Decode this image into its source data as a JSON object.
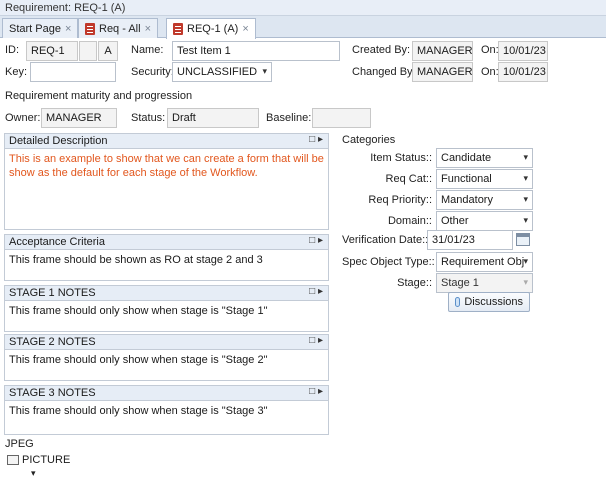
{
  "window": {
    "title": "Requirement: REQ-1 (A)"
  },
  "tabs": [
    {
      "label": "Start Page",
      "close": "×"
    },
    {
      "label": "Req - All",
      "close": "×"
    },
    {
      "label": "REQ-1 (A)",
      "close": "×"
    }
  ],
  "header": {
    "id_label": "ID:",
    "id_value": "REQ-1",
    "id_extra": "",
    "revision": "A",
    "name_label": "Name:",
    "name_value": "Test Item 1",
    "key_label": "Key:",
    "key_value": "",
    "security_label": "Security:",
    "security_value": "UNCLASSIFIED",
    "created_by_label": "Created By:",
    "created_by_value": "MANAGER",
    "created_on_label": "On:",
    "created_on_value": "10/01/23",
    "changed_by_label": "Changed By:",
    "changed_by_value": "MANAGER",
    "changed_on_label": "On:",
    "changed_on_value": "10/01/23"
  },
  "maturity": {
    "heading": "Requirement maturity and progression",
    "owner_label": "Owner:",
    "owner_value": "MANAGER",
    "status_label": "Status:",
    "status_value": "Draft",
    "baseline_label": "Baseline:",
    "baseline_value": ""
  },
  "panels": {
    "detailed": {
      "title": "Detailed Description",
      "text": "This is an example to show that we can create a form that will be show as the default for each stage of the Workflow."
    },
    "acceptance": {
      "title": "Acceptance Criteria",
      "text": "This frame should be shown as RO at stage 2 and 3"
    },
    "stage1": {
      "title": "STAGE 1 NOTES",
      "text": "This frame should only show when stage is \"Stage 1\""
    },
    "stage2": {
      "title": "STAGE 2 NOTES",
      "text": "This frame should only show when stage is \"Stage 2\""
    },
    "stage3": {
      "title": "STAGE 3 NOTES",
      "text": "This frame should only show when stage is \"Stage 3\""
    },
    "controls": "□ ▸"
  },
  "categories": {
    "heading": "Categories",
    "item_status_label": "Item Status::",
    "item_status_value": "Candidate",
    "req_cat_label": "Req Cat::",
    "req_cat_value": "Functional",
    "req_priority_label": "Req Priority::",
    "req_priority_value": "Mandatory",
    "domain_label": "Domain::",
    "domain_value": "Other",
    "verification_date_label": "Verification Date::",
    "verification_date_value": "31/01/23",
    "spec_object_type_label": "Spec Object Type::",
    "spec_object_type_value": "Requirement Obj",
    "stage_label": "Stage::",
    "stage_value": "Stage 1",
    "discussions_label": "Discussions",
    "dropdown_arrow": "▾"
  },
  "jpeg": {
    "heading": "JPEG",
    "picture_label": "PICTURE",
    "arrow": "▾"
  },
  "icons": [
    "document-icon",
    "close-icon",
    "dropdown-arrow-icon",
    "calendar-icon",
    "chat-bubble-icon",
    "picture-icon",
    "maximize-icon",
    "expand-arrow-icon"
  ],
  "colors": {
    "accent_text": "#e2571e",
    "tab_active": "#ffffff",
    "panel_header": "#e6edf6"
  }
}
